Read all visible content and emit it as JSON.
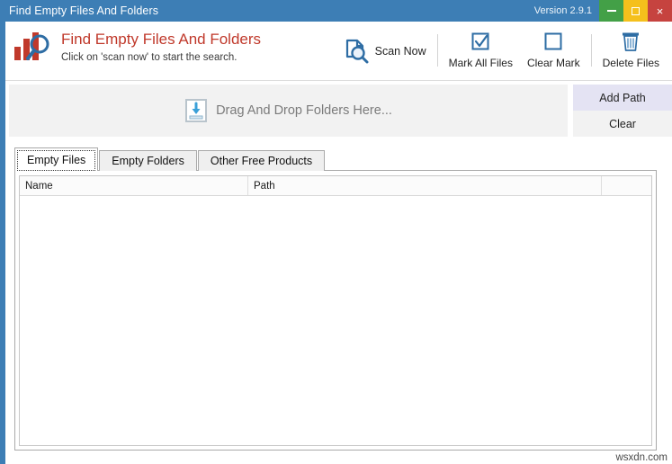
{
  "window": {
    "title": "Find Empty Files And Folders",
    "version_label": "Version 2.9.1",
    "controls": {
      "minimize": "minimize",
      "maximize": "maximize",
      "close": "×"
    },
    "colors": {
      "titlebar": "#3d7eb5",
      "minimize": "#43a047",
      "maximize": "#f5c01c",
      "close": "#c6433f",
      "brand_red": "#c0392b",
      "icon_blue": "#2e6da4",
      "add_path_bg": "#e4e3f3"
    }
  },
  "header": {
    "app_title": "Find Empty Files And Folders",
    "subtitle": "Click on 'scan now' to start the search.",
    "logo_icon": "bar-chart-magnifier-logo"
  },
  "toolbar": {
    "items": [
      {
        "label": "Scan Now",
        "icon": "document-search-icon"
      },
      {
        "label": "Mark All Files",
        "icon": "checkbox-checked-icon"
      },
      {
        "label": "Clear Mark",
        "icon": "checkbox-empty-icon"
      },
      {
        "label": "Delete Files",
        "icon": "trash-icon"
      }
    ]
  },
  "dropzone": {
    "text": "Drag And Drop Folders Here...",
    "icon": "download-into-tray-icon"
  },
  "path_buttons": {
    "add_path": "Add Path",
    "clear": "Clear"
  },
  "tabs": [
    {
      "label": "Empty Files",
      "active": true
    },
    {
      "label": "Empty Folders",
      "active": false
    },
    {
      "label": "Other Free Products",
      "active": false
    }
  ],
  "grid": {
    "columns": [
      "Name",
      "Path",
      ""
    ],
    "rows": []
  },
  "watermark": "wsxdn.com"
}
